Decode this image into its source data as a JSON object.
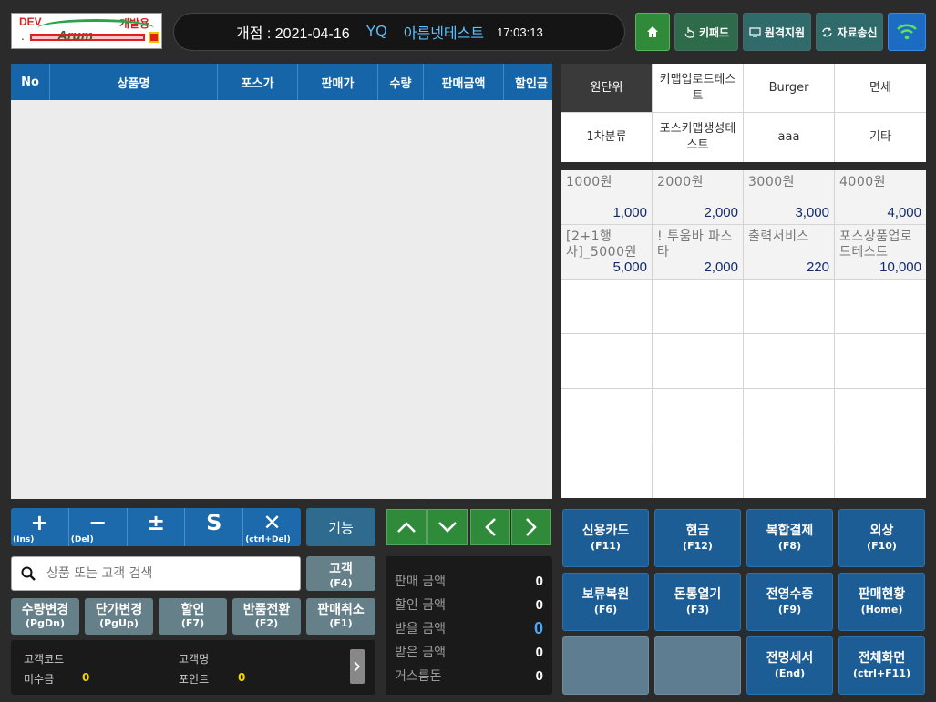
{
  "logo": {
    "dev": "DEV",
    "dev_kr": "개발용",
    "brand": "Arum",
    "dot": "."
  },
  "header": {
    "open_label": "개점 : 2021-04-16",
    "yq": "YQ",
    "store": "아름넷테스트",
    "time": "17:03:13"
  },
  "top_buttons": {
    "keypad": "키패드",
    "remote": "원격지원",
    "send": "자료송신"
  },
  "table": {
    "columns": [
      "No",
      "상품명",
      "포스가",
      "판매가",
      "수량",
      "판매금액",
      "할인금"
    ]
  },
  "categories": [
    {
      "label": "원단위",
      "selected": true
    },
    {
      "label": "키맵업로드테스트",
      "selected": false
    },
    {
      "label": "Burger",
      "selected": false
    },
    {
      "label": "면세",
      "selected": false
    },
    {
      "label": "1차분류",
      "selected": false
    },
    {
      "label": "포스키맵생성테스트",
      "selected": false
    },
    {
      "label": "aaa",
      "selected": false
    },
    {
      "label": "기타",
      "selected": false
    }
  ],
  "products": [
    {
      "name": "1000원",
      "price": "1,000"
    },
    {
      "name": "2000원",
      "price": "2,000"
    },
    {
      "name": "3000원",
      "price": "3,000"
    },
    {
      "name": "4000원",
      "price": "4,000"
    },
    {
      "name": "[2+1행사]_5000원",
      "price": "5,000"
    },
    {
      "name": "! 투움바 파스타",
      "price": "2,000"
    },
    {
      "name": "출력서비스",
      "price": "220"
    },
    {
      "name": "포스상품업로드테스트",
      "price": "10,000"
    }
  ],
  "ops": [
    {
      "symbol": "+",
      "key": "(Ins)"
    },
    {
      "symbol": "−",
      "key": "(Del)"
    },
    {
      "symbol": "±",
      "key": ""
    },
    {
      "symbol": "S",
      "key": ""
    },
    {
      "symbol": "✕",
      "key": "(ctrl+Del)"
    }
  ],
  "function_label": "기능",
  "search": {
    "placeholder": "상품 또는 고객 검색"
  },
  "customer_btn": {
    "label": "고객",
    "key": "(F4)"
  },
  "func_buttons": [
    {
      "label": "수량변경",
      "key": "(PgDn)"
    },
    {
      "label": "단가변경",
      "key": "(PgUp)"
    },
    {
      "label": "할인",
      "key": "(F7)"
    },
    {
      "label": "반품전환",
      "key": "(F2)"
    },
    {
      "label": "판매취소",
      "key": "(F1)"
    }
  ],
  "customer_panel": {
    "code_label": "고객코드",
    "name_label": "고객명",
    "unpaid_label": "미수금",
    "unpaid_value": "0",
    "point_label": "포인트",
    "point_value": "0"
  },
  "totals": [
    {
      "label": "판매 금액",
      "value": "0"
    },
    {
      "label": "할인 금액",
      "value": "0"
    },
    {
      "label": "받을 금액",
      "value": "0"
    },
    {
      "label": "받은 금액",
      "value": "0"
    },
    {
      "label": "거스름돈",
      "value": "0"
    }
  ],
  "payments": [
    {
      "label": "신용카드",
      "key": "(F11)"
    },
    {
      "label": "현금",
      "key": "(F12)"
    },
    {
      "label": "복합결제",
      "key": "(F8)"
    },
    {
      "label": "외상",
      "key": "(F10)"
    },
    {
      "label": "보류복원",
      "key": "(F6)"
    },
    {
      "label": "돈통열기",
      "key": "(F3)"
    },
    {
      "label": "전영수증",
      "key": "(F9)"
    },
    {
      "label": "판매현황",
      "key": "(Home)"
    },
    {
      "label": "",
      "key": ""
    },
    {
      "label": "",
      "key": ""
    },
    {
      "label": "전명세서",
      "key": "(End)"
    },
    {
      "label": "전체화면",
      "key": "(ctrl+F11)"
    }
  ],
  "colors": {
    "header_blue": "#1565a8",
    "accent_green": "#2f8a3a",
    "payment_blue": "#1d5d96",
    "link_blue": "#5ec0ff",
    "highlight_yellow": "#f2d400"
  }
}
